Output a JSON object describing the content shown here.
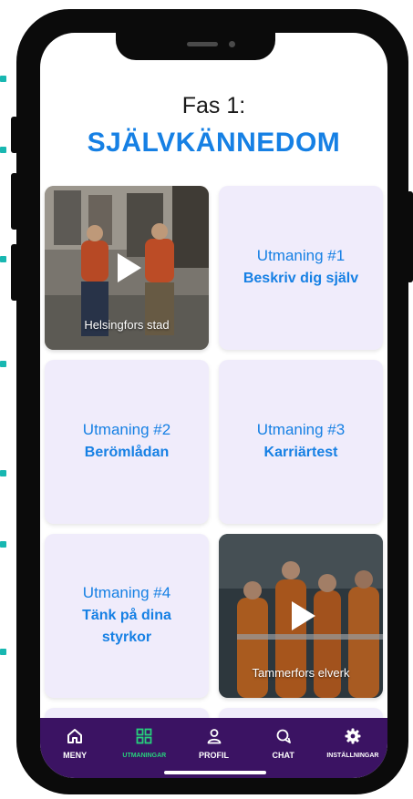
{
  "header": {
    "phase": "Fas 1:",
    "title": "SJÄLVKÄNNEDOM"
  },
  "cards": [
    {
      "type": "video",
      "caption": "Helsingfors stad"
    },
    {
      "type": "challenge",
      "number": "Utmaning #1",
      "name": "Beskriv dig själv"
    },
    {
      "type": "challenge",
      "number": "Utmaning #2",
      "name": "Berömlådan"
    },
    {
      "type": "challenge",
      "number": "Utmaning #3",
      "name": "Karriärtest"
    },
    {
      "type": "challenge",
      "number": "Utmaning #4",
      "name": "Tänk på dina styrkor"
    },
    {
      "type": "video",
      "caption": "Tammerfors elverk"
    }
  ],
  "nav": {
    "items": [
      {
        "label": "MENY",
        "icon": "home-icon"
      },
      {
        "label": "UTMANINGAR",
        "icon": "grid-icon",
        "active": true
      },
      {
        "label": "PROFIL",
        "icon": "person-icon"
      },
      {
        "label": "CHAT",
        "icon": "chat-icon"
      },
      {
        "label": "INSTÄLLNINGAR",
        "icon": "gear-icon"
      }
    ]
  },
  "colors": {
    "accent": "#1680e4",
    "nav_bg": "#3b1363",
    "nav_active": "#27d07c",
    "card_bg": "#f0ecfb",
    "dots": "#18b7b1"
  }
}
